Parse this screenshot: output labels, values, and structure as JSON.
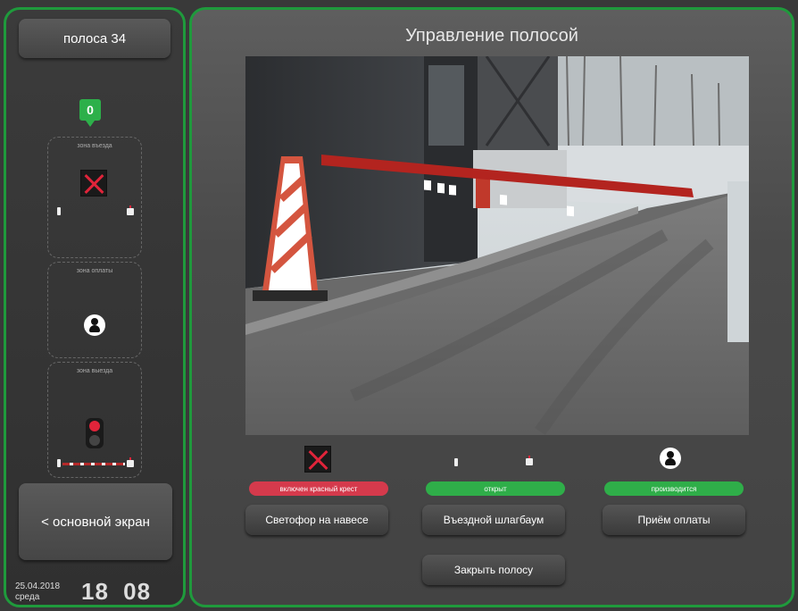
{
  "sidebar": {
    "lane_label": "полоса 34",
    "counter": "0",
    "zones": [
      {
        "label": "зона въезда"
      },
      {
        "label": "зона оплаты"
      },
      {
        "label": "зона выезда"
      }
    ],
    "main_screen_label": "< основной экран",
    "date": "25.04.2018",
    "weekday": "среда",
    "time_hours": "18",
    "time_minutes": "08"
  },
  "main": {
    "title": "Управление полосой",
    "statuses": [
      {
        "text": "включен красный крест",
        "color": "#d53a4c",
        "icon": "red-cross-icon"
      },
      {
        "text": "открыт",
        "color": "#2fae49",
        "icon": "barrier-icon"
      },
      {
        "text": "производится",
        "color": "#2fae49",
        "icon": "person-icon"
      }
    ],
    "buttons": {
      "traffic_light": "Светофор на навесе",
      "entry_barrier": "Въездной шлагбаум",
      "payment": "Приём оплаты",
      "close_lane": "Закрыть полосу"
    }
  }
}
